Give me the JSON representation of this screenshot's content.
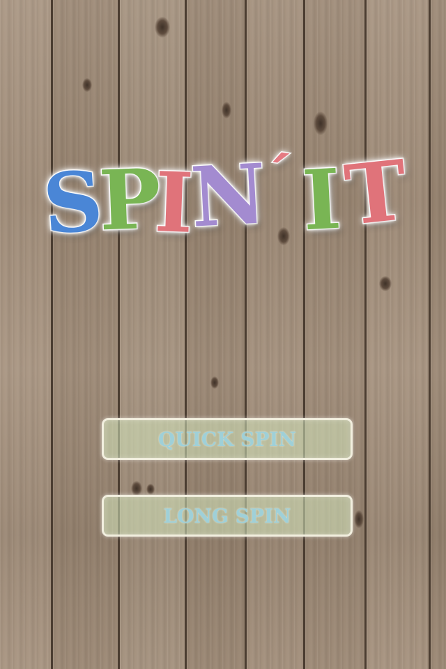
{
  "logo": {
    "letters": [
      "S",
      "P",
      "I",
      "N",
      "´",
      "I",
      "T"
    ],
    "colors": {
      "blue": "#4a86d6",
      "green": "#79b554",
      "pink": "#e0737a",
      "purple": "#a38bd0"
    }
  },
  "menu": {
    "quick_spin_label": "QUICK SPIN",
    "long_spin_label": "LONG SPIN",
    "button_text_color": "#9fd0d8",
    "button_fill_color": "#d6e7be"
  },
  "background": {
    "style": "wooden planks",
    "wood_color": "#9e8a76"
  }
}
